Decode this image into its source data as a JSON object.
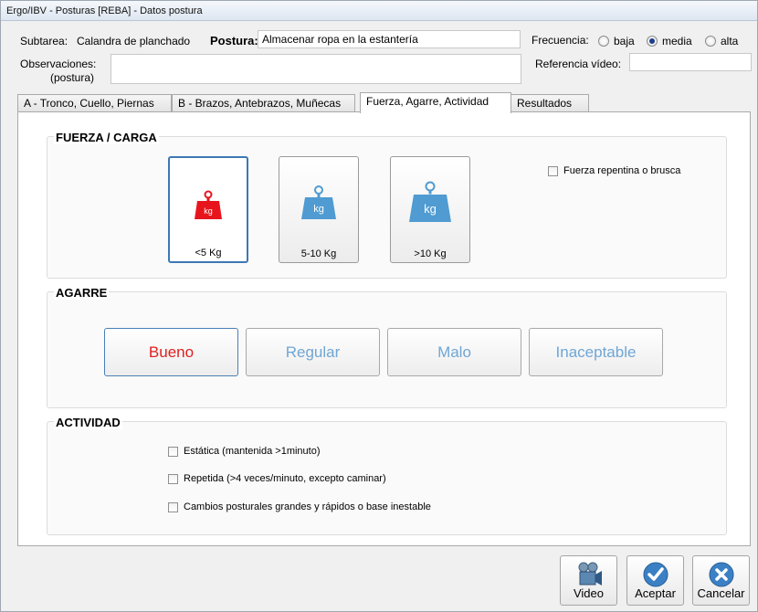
{
  "window": {
    "title": "Ergo/IBV - Posturas [REBA] - Datos postura"
  },
  "header": {
    "subtarea_label": "Subtarea:",
    "subtarea_value": "Calandra de planchado",
    "postura_label": "Postura:",
    "postura_value": "Almacenar ropa en la estantería",
    "frecuencia_label": "Frecuencia:",
    "frecuencia_options": [
      {
        "label": "baja",
        "selected": false
      },
      {
        "label": "media",
        "selected": true
      },
      {
        "label": "alta",
        "selected": false
      }
    ],
    "observaciones_label_1": "Observaciones:",
    "observaciones_label_2": "(postura)",
    "observaciones_value": "",
    "referencia_label": "Referencia vídeo:",
    "referencia_value": ""
  },
  "tabs": [
    {
      "label": "A - Tronco, Cuello, Piernas",
      "active": false
    },
    {
      "label": "B - Brazos, Antebrazos, Muñecas",
      "active": false
    },
    {
      "label": "Fuerza, Agarre, Actividad",
      "active": true
    },
    {
      "label": "Resultados",
      "active": false
    }
  ],
  "fuerza": {
    "title": "FUERZA / CARGA",
    "options": [
      {
        "label": "<5 Kg",
        "icon": "weight-icon",
        "unit": "kg",
        "color": "#e8141c",
        "selected": true
      },
      {
        "label": "5-10 Kg",
        "icon": "weight-icon",
        "unit": "kg",
        "color": "#4f9bd2",
        "selected": false
      },
      {
        "label": ">10 Kg",
        "icon": "weight-icon",
        "unit": "kg",
        "color": "#4f9bd2",
        "selected": false
      }
    ],
    "repentina_label": "Fuerza repentina o brusca",
    "repentina_checked": false
  },
  "agarre": {
    "title": "AGARRE",
    "options": [
      {
        "label": "Bueno",
        "selected": true
      },
      {
        "label": "Regular",
        "selected": false
      },
      {
        "label": "Malo",
        "selected": false
      },
      {
        "label": "Inaceptable",
        "selected": false
      }
    ],
    "selected_color": "#e02020",
    "unselected_color": "#6fa6d5"
  },
  "actividad": {
    "title": "ACTIVIDAD",
    "items": [
      {
        "label": "Estática (mantenida >1minuto)",
        "checked": false
      },
      {
        "label": "Repetida (>4 veces/minuto, excepto caminar)",
        "checked": false
      },
      {
        "label": "Cambios posturales grandes y rápidos o base inestable",
        "checked": false
      }
    ]
  },
  "footer": {
    "video_label": "Video",
    "aceptar_label": "Aceptar",
    "cancelar_label": "Cancelar"
  }
}
